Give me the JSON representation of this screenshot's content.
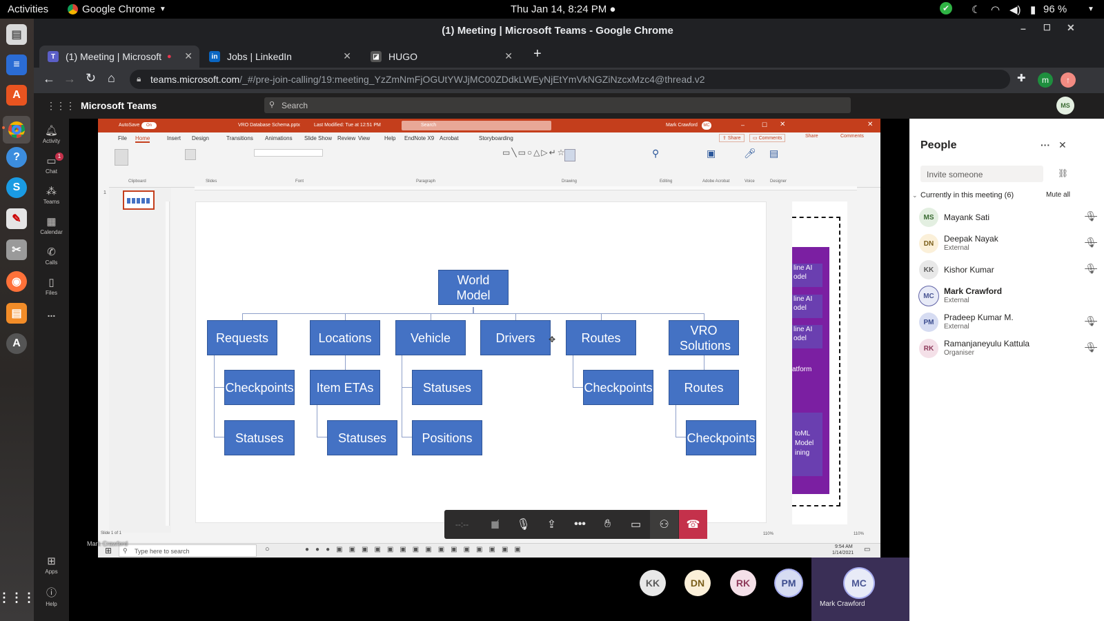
{
  "topbar": {
    "activities": "Activities",
    "app": "Google Chrome",
    "datetime": "Thu Jan 14,  8:24 PM",
    "battery": "96 %"
  },
  "window_title": "(1) Meeting | Microsoft Teams - Google Chrome",
  "tabs": [
    {
      "label": "(1) Meeting | Microsoft",
      "active": true
    },
    {
      "label": "Jobs | LinkedIn",
      "active": false
    },
    {
      "label": "HUGO",
      "active": false
    }
  ],
  "address": {
    "host": "teams.microsoft.com",
    "path": "/_#/pre-join-calling/19:meeting_YzZmNmFjOGUtYWJjMC00ZDdkLWEyNjEtYmVkNGZiNzcxMzc4@thread.v2"
  },
  "teams": {
    "title": "Microsoft Teams",
    "search_placeholder": "Search",
    "user_initials": "MS"
  },
  "rail": [
    {
      "label": "Activity",
      "icon": "bell-icon"
    },
    {
      "label": "Chat",
      "icon": "chat-icon",
      "badge": "1"
    },
    {
      "label": "Teams",
      "icon": "teams-icon"
    },
    {
      "label": "Calendar",
      "icon": "calendar-icon"
    },
    {
      "label": "Calls",
      "icon": "phone-icon"
    },
    {
      "label": "Files",
      "icon": "file-icon"
    },
    {
      "label": "...",
      "icon": "more-icon"
    },
    {
      "label": "Apps",
      "icon": "apps-icon"
    },
    {
      "label": "Help",
      "icon": "help-icon"
    }
  ],
  "ppt": {
    "autosave": "AutoSave",
    "autosave_state": "On",
    "filename": "VRO Database Schema.pptx",
    "modified": "Last Modified: Tue at 12:51 PM",
    "search": "Search",
    "user": "Mark Crawford",
    "user_initials": "MC",
    "share": "Share",
    "comments": "Comments",
    "menus": [
      "File",
      "Home",
      "Insert",
      "Design",
      "Transitions",
      "Animations",
      "Slide Show",
      "Review",
      "View",
      "Help",
      "EndNote X9",
      "Acrobat",
      "Storyboarding"
    ],
    "groups": [
      "Clipboard",
      "Slides",
      "Font",
      "Paragraph",
      "Drawing",
      "Editing",
      "Adobe Acrobat",
      "Voice",
      "Designer"
    ],
    "slide_number": "1",
    "status": "Slide 1 of 1",
    "zoom": "110%"
  },
  "diagram": {
    "root": "World Model",
    "level1": [
      "Requests",
      "Locations",
      "Vehicle",
      "Drivers",
      "Routes",
      "VRO Solutions"
    ],
    "children": {
      "requests": [
        "Checkpoints",
        "Statuses"
      ],
      "locations": [
        "Item ETAs",
        "Statuses"
      ],
      "vehicle": [
        "Statuses",
        "Positions"
      ],
      "routes": [
        "Checkpoints"
      ],
      "vro": [
        "Routes",
        "Checkpoints"
      ]
    },
    "bg_snippets": [
      "line AI",
      "odel",
      "line AI",
      "odel",
      "line AI",
      "odel",
      "atform",
      "toML",
      "Model",
      "ining"
    ]
  },
  "win_taskbar": {
    "search": "Type here to search",
    "time": "9:54 AM",
    "date": "1/14/2021"
  },
  "presenter_label": "Mark Crawford",
  "participants": [
    {
      "initials": "KK",
      "bg": "#e8e8e8",
      "fg": "#5b5b5b"
    },
    {
      "initials": "DN",
      "bg": "#fbf0d9",
      "fg": "#7a5e1a"
    },
    {
      "initials": "RK",
      "bg": "#f4e0e8",
      "fg": "#8e3a5a"
    },
    {
      "initials": "PM",
      "bg": "#d6dcf2",
      "fg": "#3c4d8f"
    }
  ],
  "active_speaker": {
    "initials": "MC",
    "name": "Mark Crawford"
  },
  "people": {
    "title": "People",
    "invite_placeholder": "Invite someone",
    "section": "Currently in this meeting (6)",
    "mute_all": "Mute all",
    "list": [
      {
        "initials": "MS",
        "name": "Mayank Sati",
        "sub": "",
        "bg": "#e3efe1",
        "fg": "#3a6b33",
        "bold": false
      },
      {
        "initials": "DN",
        "name": "Deepak Nayak",
        "sub": "External",
        "bg": "#fbf0d9",
        "fg": "#7a5e1a",
        "bold": false
      },
      {
        "initials": "KK",
        "name": "Kishor Kumar",
        "sub": "",
        "bg": "#e8e8e8",
        "fg": "#5b5b5b",
        "bold": false
      },
      {
        "initials": "MC",
        "name": "Mark Crawford",
        "sub": "External",
        "bg": "#e8ebf7",
        "fg": "#4a5694",
        "bold": true
      },
      {
        "initials": "PM",
        "name": "Pradeep Kumar M.",
        "sub": "External",
        "bg": "#d6dcf2",
        "fg": "#3c4d8f",
        "bold": false
      },
      {
        "initials": "RK",
        "name": "Ramanjaneyulu Kattula",
        "sub": "Organiser",
        "bg": "#f4e0e8",
        "fg": "#8e3a5a",
        "bold": false
      }
    ]
  }
}
